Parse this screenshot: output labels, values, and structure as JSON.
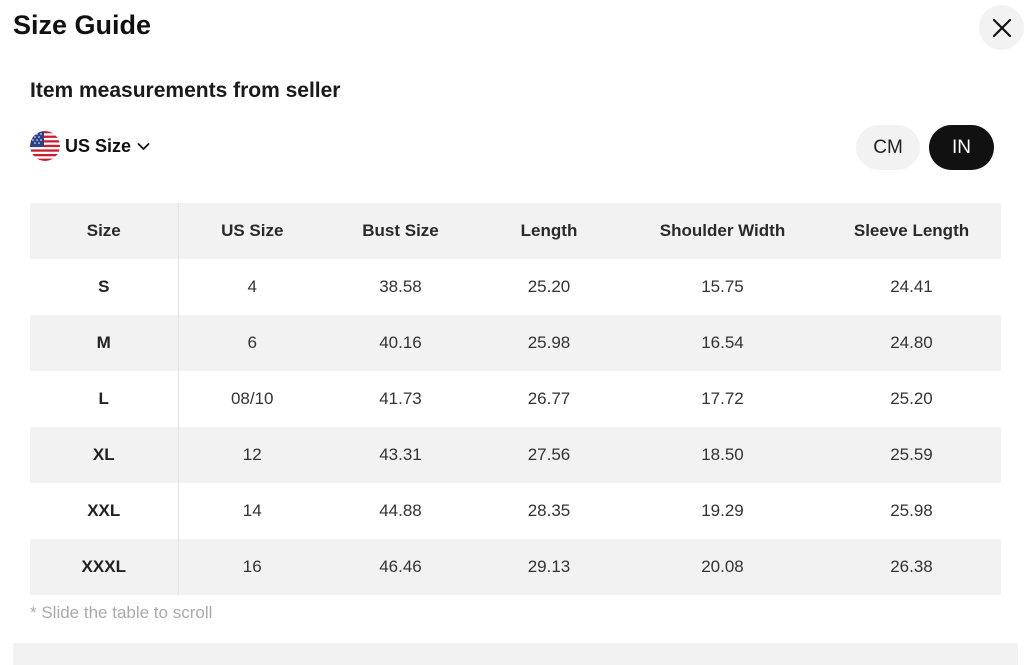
{
  "modal": {
    "title": "Size Guide",
    "subtitle": "Item measurements from seller",
    "hint": "* Slide the table to scroll"
  },
  "size_system": {
    "selected": "US Size",
    "flag_icon": "us-flag-icon"
  },
  "units": {
    "options": [
      "CM",
      "IN"
    ],
    "selected": "IN",
    "active_color": "#111111",
    "inactive_color": "#f2f2f2"
  },
  "table": {
    "headers": [
      "Size",
      "US Size",
      "Bust Size",
      "Length",
      "Shoulder Width",
      "Sleeve Length"
    ],
    "rows": [
      [
        "S",
        "4",
        "38.58",
        "25.20",
        "15.75",
        "24.41"
      ],
      [
        "M",
        "6",
        "40.16",
        "25.98",
        "16.54",
        "24.80"
      ],
      [
        "L",
        "08/10",
        "41.73",
        "26.77",
        "17.72",
        "25.20"
      ],
      [
        "XL",
        "12",
        "43.31",
        "27.56",
        "18.50",
        "25.59"
      ],
      [
        "XXL",
        "14",
        "44.88",
        "28.35",
        "19.29",
        "25.98"
      ],
      [
        "XXXL",
        "16",
        "46.46",
        "29.13",
        "20.08",
        "26.38"
      ]
    ]
  }
}
